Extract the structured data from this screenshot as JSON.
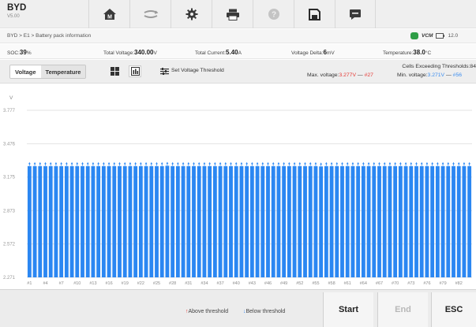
{
  "app": {
    "name": "BYD",
    "version": "V5.00"
  },
  "toolbar": {
    "buttons": [
      {
        "name": "home-button",
        "icon": "home-icon"
      },
      {
        "name": "vehicle-swap-button",
        "icon": "vehicle-swap-icon"
      },
      {
        "name": "settings-button",
        "icon": "gear-icon"
      },
      {
        "name": "print-button",
        "icon": "printer-icon"
      },
      {
        "name": "help-button",
        "icon": "help-icon"
      },
      {
        "name": "save-button",
        "icon": "save-icon"
      },
      {
        "name": "message-button",
        "icon": "message-icon"
      }
    ]
  },
  "breadcrumb": {
    "path": "BYD > E1 > Battery pack information"
  },
  "status_indicator": {
    "vcm_label": "VCM",
    "battery_text": "12.0"
  },
  "stats": {
    "soc_label": "SOC:",
    "soc_value": "39",
    "soc_unit": "%",
    "voltage_label": "Total Voltage:",
    "voltage_value": "340.00",
    "voltage_unit": "V",
    "current_label": "Total Current:",
    "current_value": "5.40",
    "current_unit": "A",
    "delta_label": "Voltage Delta:",
    "delta_value": "6",
    "delta_unit": "mV",
    "temp_label": "Temperature:",
    "temp_value": "38.0",
    "temp_unit": "°C"
  },
  "controls": {
    "tab_voltage": "Voltage",
    "tab_temperature": "Temperature",
    "threshold_button": "Set Voltage Threshold",
    "cells_exceeding": "Cells Exceeding Thresholds:84",
    "max_label": "Max. voltage:",
    "max_value": "3.277V",
    "max_dash": "—",
    "max_cell": "#27",
    "min_label": "Min. voltage:",
    "min_value": "3.271V",
    "min_dash": "—",
    "min_cell": "#56"
  },
  "colors": {
    "bar": "#2b87f2",
    "max_text": "#e53935",
    "min_text": "#3d8ef0",
    "vcm_dot": "#2e9d46"
  },
  "chart_data": {
    "type": "bar",
    "title": "",
    "ylabel": "V",
    "xlabel": "",
    "ylim": [
      2.271,
      3.777
    ],
    "yticks": [
      3.777,
      3.476,
      3.175,
      2.873,
      2.572,
      2.271
    ],
    "grid": true,
    "cell_count": 84,
    "x_tick_labels": [
      "#1",
      "#4",
      "#7",
      "#10",
      "#13",
      "#16",
      "#19",
      "#22",
      "#25",
      "#28",
      "#31",
      "#34",
      "#37",
      "#40",
      "#43",
      "#46",
      "#49",
      "#52",
      "#55",
      "#58",
      "#61",
      "#64",
      "#67",
      "#70",
      "#73",
      "#76",
      "#79",
      "#82"
    ],
    "categories": [
      "#1",
      "#2",
      "#3",
      "#4",
      "#5",
      "#6",
      "#7",
      "#8",
      "#9",
      "#10",
      "#11",
      "#12",
      "#13",
      "#14",
      "#15",
      "#16",
      "#17",
      "#18",
      "#19",
      "#20",
      "#21",
      "#22",
      "#23",
      "#24",
      "#25",
      "#26",
      "#27",
      "#28",
      "#29",
      "#30",
      "#31",
      "#32",
      "#33",
      "#34",
      "#35",
      "#36",
      "#37",
      "#38",
      "#39",
      "#40",
      "#41",
      "#42",
      "#43",
      "#44",
      "#45",
      "#46",
      "#47",
      "#48",
      "#49",
      "#50",
      "#51",
      "#52",
      "#53",
      "#54",
      "#55",
      "#56",
      "#57",
      "#58",
      "#59",
      "#60",
      "#61",
      "#62",
      "#63",
      "#64",
      "#65",
      "#66",
      "#67",
      "#68",
      "#69",
      "#70",
      "#71",
      "#72",
      "#73",
      "#74",
      "#75",
      "#76",
      "#77",
      "#78",
      "#79",
      "#80",
      "#81",
      "#82",
      "#83",
      "#84"
    ],
    "values": [
      3.274,
      3.274,
      3.274,
      3.274,
      3.274,
      3.274,
      3.274,
      3.274,
      3.274,
      3.274,
      3.274,
      3.274,
      3.274,
      3.274,
      3.274,
      3.274,
      3.274,
      3.274,
      3.274,
      3.274,
      3.274,
      3.274,
      3.274,
      3.274,
      3.274,
      3.274,
      3.277,
      3.274,
      3.274,
      3.274,
      3.274,
      3.274,
      3.274,
      3.274,
      3.274,
      3.274,
      3.274,
      3.274,
      3.274,
      3.274,
      3.274,
      3.274,
      3.274,
      3.274,
      3.274,
      3.274,
      3.274,
      3.274,
      3.274,
      3.274,
      3.274,
      3.274,
      3.274,
      3.274,
      3.274,
      3.271,
      3.274,
      3.274,
      3.274,
      3.274,
      3.274,
      3.274,
      3.274,
      3.274,
      3.274,
      3.274,
      3.274,
      3.274,
      3.274,
      3.274,
      3.274,
      3.274,
      3.274,
      3.274,
      3.274,
      3.274,
      3.274,
      3.274,
      3.274,
      3.274,
      3.274,
      3.274,
      3.274,
      3.274
    ],
    "markers": "up-arrow above each bar"
  },
  "footer": {
    "above_arrow": "↑",
    "above_label": "Above threshold",
    "below_arrow": "↓",
    "below_label": "Below threshold",
    "start": "Start",
    "end": "End",
    "esc": "ESC"
  }
}
